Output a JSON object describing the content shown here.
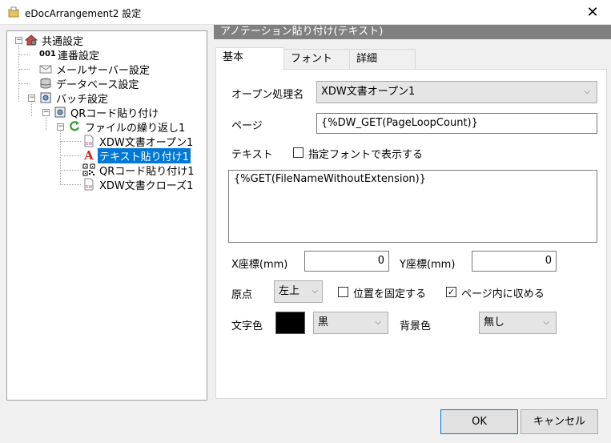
{
  "window": {
    "title": "eDocArrangement2 設定",
    "close_glyph": "✕"
  },
  "tree": {
    "items": [
      {
        "label": "共通設定",
        "icon": "house-gear-icon"
      },
      {
        "label": "連番設定",
        "icon": "serial-number-icon",
        "prefix": "001"
      },
      {
        "label": "メールサーバー設定",
        "icon": "envelope-icon"
      },
      {
        "label": "データベース設定",
        "icon": "database-icon"
      },
      {
        "label": "バッチ設定",
        "icon": "batch-icon"
      },
      {
        "label": "QRコード貼り付け",
        "icon": "batch-icon"
      },
      {
        "label": "ファイルの繰り返し1",
        "icon": "loop-arrow-icon"
      },
      {
        "label": "XDW文書オープン1",
        "icon": "docuworks-file-icon",
        "dw": "DW"
      },
      {
        "label": "テキスト貼り付け1",
        "icon": "text-a-icon",
        "glyph": "A"
      },
      {
        "label": "QRコード貼り付け1",
        "icon": "qr-code-icon"
      },
      {
        "label": "XDW文書クローズ1",
        "icon": "docuworks-file-icon",
        "dw": "DW"
      }
    ]
  },
  "panel": {
    "header": "アノテーション貼り付け(テキスト)",
    "tabs": [
      "基本",
      "フォント",
      "詳細"
    ],
    "open_process": {
      "label": "オープン処理名",
      "value": "XDW文書オープン1"
    },
    "page": {
      "label": "ページ",
      "value": "{%DW_GET(PageLoopCount)}"
    },
    "text": {
      "label": "テキスト",
      "font_checkbox_label": "指定フォントで表示する",
      "font_checkbox_checked": false,
      "content": "{%GET(FileNameWithoutExtension)}"
    },
    "x": {
      "label": "X座標(mm)",
      "value": "0"
    },
    "y": {
      "label": "Y座標(mm)",
      "value": "0"
    },
    "origin": {
      "label": "原点",
      "value": "左上"
    },
    "fix_position": {
      "label": "位置を固定する",
      "checked": false
    },
    "fit_page": {
      "label": "ページ内に収める",
      "checked": true
    },
    "text_color": {
      "label": "文字色",
      "swatch": "#000000",
      "value": "黒"
    },
    "bg_color": {
      "label": "背景色",
      "value": "無し"
    },
    "check_glyph": "✓"
  },
  "buttons": {
    "ok": "OK",
    "cancel": "キャンセル"
  }
}
